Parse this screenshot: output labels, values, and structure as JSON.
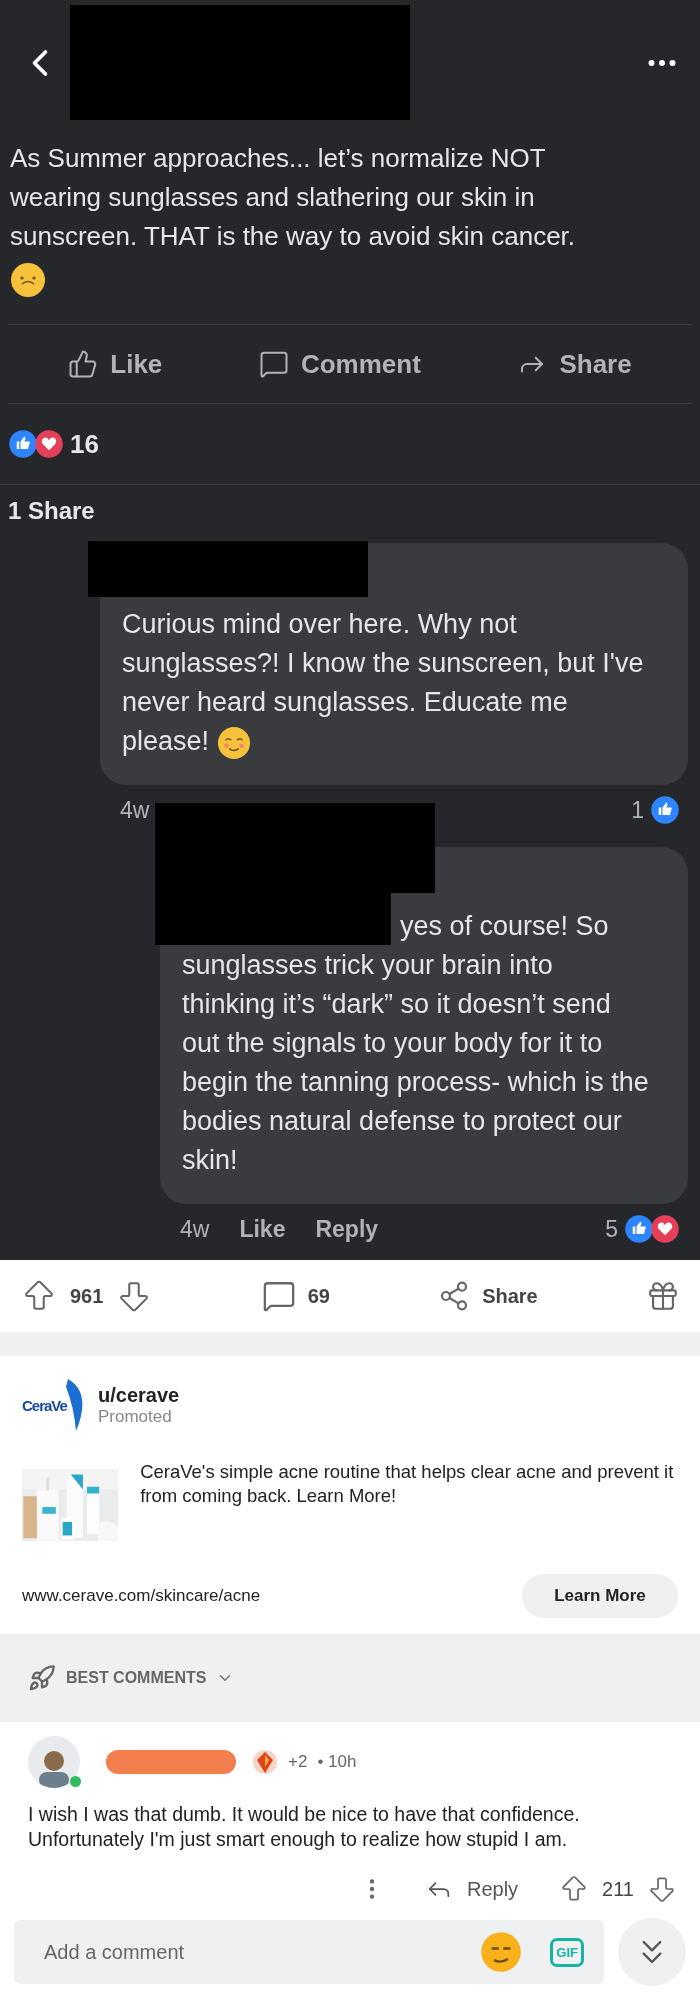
{
  "fb_post": {
    "text": "As Summer approaches... let’s normalize NOT wearing sunglasses and slathering our skin in sunscreen. THAT is the way to avoid skin cancer.",
    "emoji": {
      "kind": "upside-down"
    },
    "actions": [
      {
        "label": "Like",
        "kind": "like"
      },
      {
        "label": "Comment",
        "kind": "comment"
      },
      {
        "label": "Share",
        "kind": "share"
      }
    ],
    "reactions": [
      {
        "kind": "like"
      },
      {
        "kind": "love"
      }
    ],
    "reaction_count": "16",
    "shares": "1 Share",
    "comments": [
      {
        "text": "Curious mind over here. Why not sunglasses?! I know the sunscreen, but I've never heard sunglasses. Educate me please!",
        "emoji": {
          "kind": "blush"
        },
        "time": "4w",
        "count": "1",
        "reactions": [
          {
            "kind": "like"
          }
        ]
      },
      {
        "text": "yes of course! So sunglasses trick your brain into thinking it’s “dark” so it doesn’t send out the signals to your body for it to begin the tanning process- which is the bodies natural defense to protect our skin!",
        "time": "4w",
        "actions": [
          "Like",
          "Reply"
        ],
        "count": "5",
        "reactions": [
          {
            "kind": "like"
          },
          {
            "kind": "love"
          }
        ]
      }
    ]
  },
  "post_bar": {
    "upvotes": "961",
    "comments": "69",
    "share": "Share"
  },
  "ad": {
    "logo_text": "CeraVe",
    "user": "u/cerave",
    "tag": "Promoted",
    "description": "CeraVe's simple acne routine that helps clear acne and prevent it from coming back. Learn More!",
    "url": "www.cerave.com/skincare/acne",
    "button": "Learn More"
  },
  "sort": {
    "label": "BEST COMMENTS"
  },
  "comment": {
    "awards": "+2",
    "time": "• 10h",
    "online": true,
    "text": "I wish I was that dumb. It would be nice to have that confidence. Unfortunately I'm just smart enough to realize how stupid I am.",
    "reply": "Reply",
    "score": "211"
  },
  "composer": {
    "placeholder": "Add a comment",
    "gif": "GIF"
  }
}
